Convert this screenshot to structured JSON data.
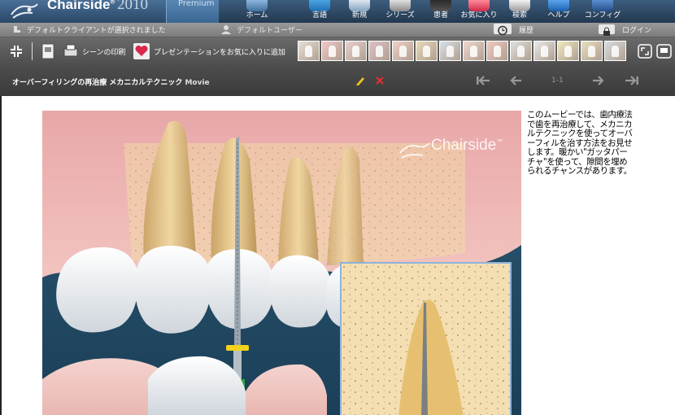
{
  "header": {
    "brand_name": "Chairside",
    "brand_mark": "®",
    "brand_year": "2010",
    "edition": "Premium",
    "nav": [
      {
        "label": "ホーム",
        "icon": "home-icon"
      },
      {
        "label": "言語",
        "icon": "language-icon"
      },
      {
        "label": "新規",
        "icon": "new-icon"
      },
      {
        "label": "シリーズ",
        "icon": "series-icon"
      },
      {
        "label": "患者",
        "icon": "patient-icon"
      },
      {
        "label": "お気に入り",
        "icon": "favorites-icon"
      },
      {
        "label": "検索",
        "icon": "search-icon"
      },
      {
        "label": "ヘルプ",
        "icon": "help-icon"
      },
      {
        "label": "コンフィグ",
        "icon": "config-icon"
      }
    ]
  },
  "statusbar": {
    "client": "デフォルトクライアントが選択されました",
    "user": "デフォルトユーザー",
    "history": "履歴",
    "login": "ログイン"
  },
  "toolbar": {
    "print_scene": "シーンの印刷",
    "add_favorite": "プレゼンテーションをお気に入りに追加",
    "thumbnails": [
      "thumb-1",
      "thumb-2",
      "thumb-3",
      "thumb-4",
      "thumb-5",
      "thumb-6",
      "thumb-7",
      "thumb-8",
      "thumb-9",
      "thumb-10",
      "thumb-11",
      "thumb-12",
      "thumb-13",
      "thumb-14"
    ]
  },
  "titlebar": {
    "title": "オーバーフィリングの再治療 メカニカルテクニック",
    "media_type": "Movie",
    "page": "1-1"
  },
  "content": {
    "description": "このムービーでは、歯内療法で歯を再治療して、メカニカルテクニックを使ってオーバーフィルを治す方法をお見せします。暖かい\"ガッタパーチャ\"を使って、隙間を埋められるチャンスがあります。",
    "watermark": "Chairside",
    "watermark_mark": "™"
  },
  "colors": {
    "header": "#2a4766",
    "accent_red": "#e03030",
    "pencil": "#f0c020"
  }
}
